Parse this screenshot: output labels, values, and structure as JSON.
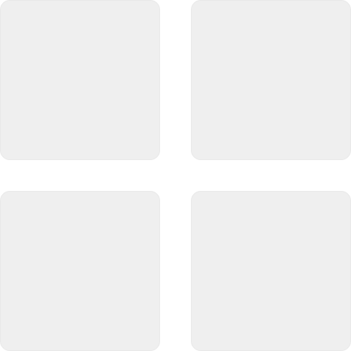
{
  "icon": {
    "name": "grid-view-icon",
    "tile_color": "#efefef",
    "tile_border_color": "#e8e8e8",
    "background_color": "#ffffff",
    "tiles": [
      {
        "name": "grid-tile-top-left"
      },
      {
        "name": "grid-tile-top-right"
      },
      {
        "name": "grid-tile-bottom-left"
      },
      {
        "name": "grid-tile-bottom-right"
      }
    ]
  }
}
